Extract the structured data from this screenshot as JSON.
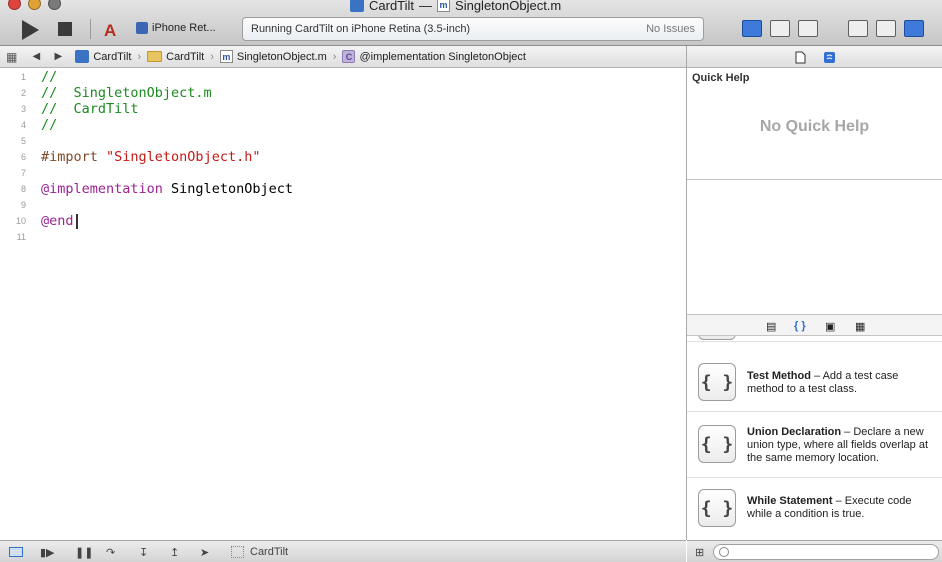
{
  "window": {
    "title": "CardTilt",
    "title_sep": "—",
    "file_badge": "m",
    "file_title": "SingletonObject.m"
  },
  "toolbar": {
    "scheme_device": "iPhone Ret...",
    "activity_message": "Running CardTilt on iPhone Retina (3.5-inch)",
    "issues": "No Issues"
  },
  "jumpbar": {
    "crumbs": [
      {
        "label": "CardTilt",
        "icon": "project-icon"
      },
      {
        "label": "CardTilt",
        "icon": "folder-icon"
      },
      {
        "label": "SingletonObject.m",
        "icon": "m-file-icon",
        "badge": "m"
      },
      {
        "label": "@implementation SingletonObject",
        "icon": "class-icon",
        "badge": "C"
      }
    ]
  },
  "editor": {
    "lines": [
      {
        "n": "1"
      },
      {
        "n": "2"
      },
      {
        "n": "3"
      },
      {
        "n": "4"
      },
      {
        "n": "5"
      },
      {
        "n": "6"
      },
      {
        "n": "7"
      },
      {
        "n": "8"
      },
      {
        "n": "9"
      },
      {
        "n": "10"
      },
      {
        "n": "11"
      }
    ],
    "l1": "//",
    "l2": "//  SingletonObject.m",
    "l3": "//  CardTilt",
    "l4": "//",
    "l6_directive": "#import ",
    "l6_string": "\"SingletonObject.h\"",
    "l8_keyword": "@implementation",
    "l8_name": " SingletonObject",
    "l10_keyword": "@end"
  },
  "inspector": {
    "quick_help_title": "Quick Help",
    "quick_help_empty": "No Quick Help"
  },
  "library": {
    "items": [
      {
        "name": "Test Method",
        "desc": " – Add a test case method to a test class.",
        "icon": "{ }"
      },
      {
        "name": "Union Declaration",
        "desc": " – Declare a new union type, where all fields overlap at the same memory location.",
        "icon": "{ }"
      },
      {
        "name": "While Statement",
        "desc": " – Execute code while a condition is true.",
        "icon": "{ }"
      }
    ]
  },
  "debugbar": {
    "target": "CardTilt"
  },
  "colors": {
    "comment": "#1b8a20",
    "keyword": "#9b2393",
    "string": "#c41a16",
    "accent": "#3d7ad9"
  }
}
